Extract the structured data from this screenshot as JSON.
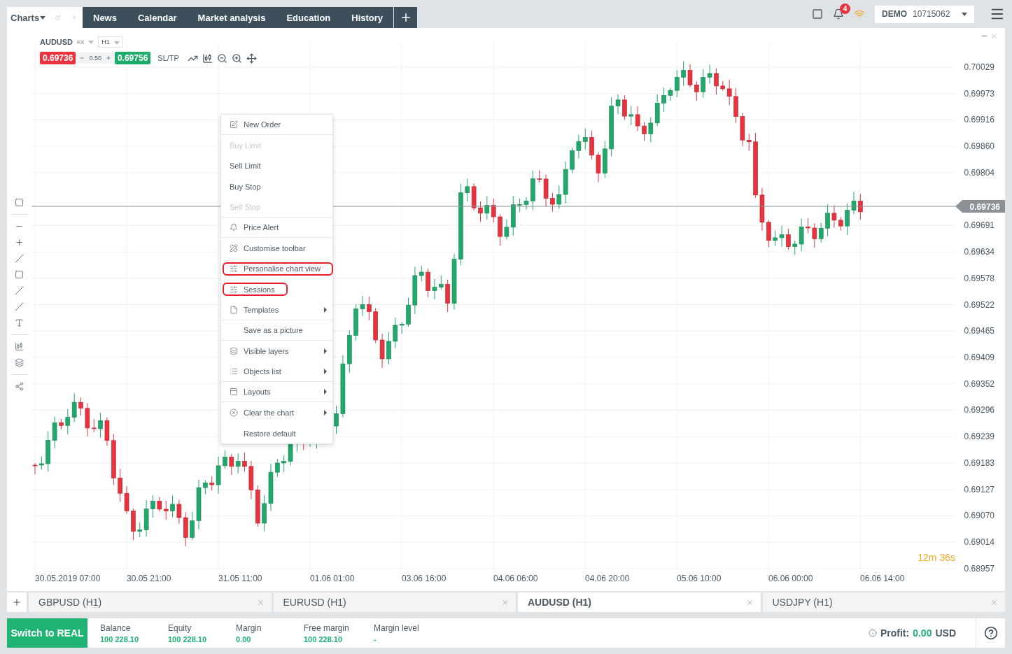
{
  "top_tabs": [
    {
      "label": "Charts",
      "selected": true
    },
    {
      "label": "News",
      "selected": false
    },
    {
      "label": "Calendar",
      "selected": false
    },
    {
      "label": "Market analysis",
      "selected": false
    },
    {
      "label": "Education",
      "selected": false
    },
    {
      "label": "History",
      "selected": false
    }
  ],
  "notifications": {
    "count": "4"
  },
  "account": {
    "mode": "DEMO",
    "number": "10715062"
  },
  "chart": {
    "symbol": "AUDUSD",
    "market": "FX",
    "timeframe": "H1",
    "sell_price": "0.69736",
    "spread": "0.50",
    "buy_price": "0.69756",
    "sltp": "SL/TP",
    "current_price": "0.69736",
    "countdown": "12m 36s",
    "price_ticks": [
      "0.70029",
      "0.69973",
      "0.69916",
      "0.69860",
      "0.69804",
      "0.69691",
      "0.69634",
      "0.69578",
      "0.69522",
      "0.69465",
      "0.69409",
      "0.69352",
      "0.69296",
      "0.69239",
      "0.69183",
      "0.69127",
      "0.69070",
      "0.69014",
      "0.68957"
    ],
    "time_labels": [
      "30.05.2019 07:00",
      "30.05 21:00",
      "31.05 11:00",
      "01.06 01:00",
      "03.06 16:00",
      "04.06 06:00",
      "04.06 20:00",
      "05.06 10:00",
      "06.06 00:00",
      "06.06 14:00"
    ]
  },
  "context_menu": [
    {
      "label": "New Order",
      "disabled": false,
      "highlighted": false,
      "submenu": false,
      "separator_after": true
    },
    {
      "label": "Buy Limit",
      "disabled": true,
      "highlighted": false,
      "submenu": false,
      "separator_after": false
    },
    {
      "label": "Sell Limit",
      "disabled": false,
      "highlighted": false,
      "submenu": false,
      "separator_after": false
    },
    {
      "label": "Buy Stop",
      "disabled": false,
      "highlighted": false,
      "submenu": false,
      "separator_after": false
    },
    {
      "label": "Sell Stop",
      "disabled": true,
      "highlighted": false,
      "submenu": false,
      "separator_after": true
    },
    {
      "label": "Price Alert",
      "disabled": false,
      "highlighted": false,
      "submenu": false,
      "separator_after": true
    },
    {
      "label": "Customise toolbar",
      "disabled": false,
      "highlighted": false,
      "submenu": false,
      "separator_after": false
    },
    {
      "label": "Personalise chart view",
      "disabled": false,
      "highlighted": true,
      "submenu": false,
      "separator_after": false
    },
    {
      "label": "Sessions",
      "disabled": false,
      "highlighted": true,
      "submenu": false,
      "separator_after": false
    },
    {
      "label": "Templates",
      "disabled": false,
      "highlighted": false,
      "submenu": true,
      "separator_after": true
    },
    {
      "label": "Save as a picture",
      "disabled": false,
      "highlighted": false,
      "submenu": false,
      "separator_after": true
    },
    {
      "label": "Visible layers",
      "disabled": false,
      "highlighted": false,
      "submenu": true,
      "separator_after": false
    },
    {
      "label": "Objects list",
      "disabled": false,
      "highlighted": false,
      "submenu": true,
      "separator_after": true
    },
    {
      "label": "Layouts",
      "disabled": false,
      "highlighted": false,
      "submenu": true,
      "separator_after": true
    },
    {
      "label": "Clear the chart",
      "disabled": false,
      "highlighted": false,
      "submenu": true,
      "separator_after": false
    },
    {
      "label": "Restore default",
      "disabled": false,
      "highlighted": false,
      "submenu": false,
      "separator_after": false
    }
  ],
  "chart_tabs": [
    {
      "label": "GBPUSD (H1)",
      "selected": false
    },
    {
      "label": "EURUSD (H1)",
      "selected": false
    },
    {
      "label": "AUDUSD (H1)",
      "selected": true
    },
    {
      "label": "USDJPY (H1)",
      "selected": false
    }
  ],
  "status_bar": {
    "switch_button": "Switch to REAL",
    "stats": [
      {
        "label": "Balance",
        "value": "100 228.10"
      },
      {
        "label": "Equity",
        "value": "100 228.10"
      },
      {
        "label": "Margin",
        "value": "0.00"
      },
      {
        "label": "Free margin",
        "value": "100 228.10"
      },
      {
        "label": "Margin level",
        "value": "-"
      }
    ],
    "profit_label": "Profit:",
    "profit_value": "0.00",
    "profit_currency": "USD"
  }
}
